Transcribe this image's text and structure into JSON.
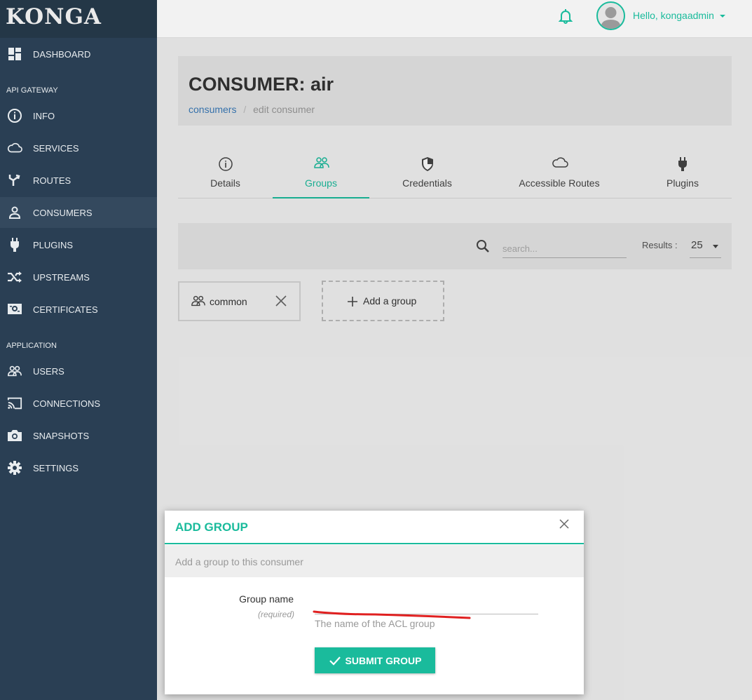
{
  "app": {
    "logo": "KONGA"
  },
  "topbar": {
    "greeting": "Hello, kongaadmin"
  },
  "sidebar": {
    "items": [
      {
        "label": "DASHBOARD",
        "icon": "dashboard-icon"
      },
      {
        "section": "API GATEWAY"
      },
      {
        "label": "INFO",
        "icon": "info-icon"
      },
      {
        "label": "SERVICES",
        "icon": "cloud-icon"
      },
      {
        "label": "ROUTES",
        "icon": "routes-icon"
      },
      {
        "label": "CONSUMERS",
        "icon": "user-icon",
        "active": true
      },
      {
        "label": "PLUGINS",
        "icon": "plug-icon"
      },
      {
        "label": "UPSTREAMS",
        "icon": "shuffle-icon"
      },
      {
        "label": "CERTIFICATES",
        "icon": "certificate-icon"
      },
      {
        "section": "APPLICATION"
      },
      {
        "label": "USERS",
        "icon": "users-icon"
      },
      {
        "label": "CONNECTIONS",
        "icon": "cast-icon"
      },
      {
        "label": "SNAPSHOTS",
        "icon": "camera-icon"
      },
      {
        "label": "SETTINGS",
        "icon": "gear-icon"
      }
    ]
  },
  "header": {
    "title": "CONSUMER: air",
    "breadcrumb": {
      "link": "consumers",
      "separator": "/",
      "current": "edit consumer"
    }
  },
  "tabs": [
    {
      "label": "Details",
      "icon": "info-icon"
    },
    {
      "label": "Groups",
      "icon": "users-icon",
      "active": true
    },
    {
      "label": "Credentials",
      "icon": "shield-icon"
    },
    {
      "label": "Accessible Routes",
      "icon": "cloud-icon"
    },
    {
      "label": "Plugins",
      "icon": "plug-icon"
    }
  ],
  "search": {
    "placeholder": "search...",
    "results_label": "Results :",
    "results_value": "25"
  },
  "groups": [
    {
      "name": "common"
    }
  ],
  "add_group_label": "Add a group",
  "modal": {
    "title": "ADD GROUP",
    "subtitle": "Add a group to this consumer",
    "field_label": "Group name",
    "field_required": "(required)",
    "field_value": "",
    "field_help": "The name of the ACL group",
    "submit_label": "SUBMIT GROUP"
  },
  "colors": {
    "accent": "#1abb9c",
    "sidebar": "#2a3f54",
    "annotation": "#e02020"
  }
}
